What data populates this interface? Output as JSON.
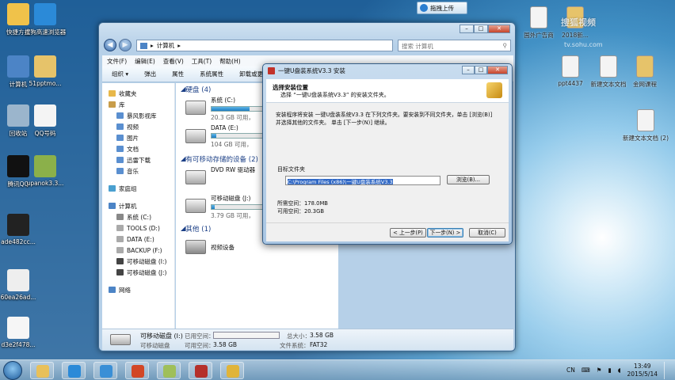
{
  "desktop": {
    "left_icons": [
      {
        "label": "快捷方式",
        "color": "#f0c24a"
      },
      {
        "label": "搜狗高速浏览器",
        "color": "#2b8ad8"
      },
      {
        "label": "计算机",
        "color": "#4c84c6"
      },
      {
        "label": "51pptmo...",
        "color": "#e6c36a"
      },
      {
        "label": "回收站",
        "color": "#9bb5cc"
      },
      {
        "label": "QQ号码",
        "color": "#f4f4f4"
      },
      {
        "label": "腾讯QQ",
        "color": "#111111"
      },
      {
        "label": "upanok3.3...",
        "color": "#8bb04a"
      },
      {
        "label": "ade482cc...",
        "color": "#222222"
      },
      {
        "label": "60ea26ad...",
        "color": "#eeeeee"
      },
      {
        "label": "d3e2f478...",
        "color": "#f6f6f6"
      }
    ],
    "right_icons": [
      {
        "label": "国外广告商",
        "color": "#f4f4f4"
      },
      {
        "label": "2018新...",
        "color": "#e6c36a"
      },
      {
        "label": "ppt4437",
        "color": "#f4f4f4"
      },
      {
        "label": "新建文本文档",
        "color": "#f4f4f4"
      },
      {
        "label": "金网课程",
        "color": "#e6c36a"
      },
      {
        "label": "新建文本文档 (2)",
        "color": "#f4f4f4"
      }
    ],
    "top_button": "拖拽上传",
    "watermark": "搜狐视频",
    "watermark_url": "tv.sohu.com"
  },
  "explorer": {
    "address": [
      "计算机"
    ],
    "search_placeholder": "搜索 计算机",
    "menu": [
      "文件(F)",
      "编辑(E)",
      "查看(V)",
      "工具(T)",
      "帮助(H)"
    ],
    "toolbar": [
      "组织 ▾",
      "弹出",
      "属性",
      "系统属性",
      "卸载或更改程序"
    ],
    "nav": [
      {
        "label": "收藏夹",
        "level": 0,
        "color": "#e8b84a"
      },
      {
        "label": "库",
        "level": 0,
        "color": "#c89d4a"
      },
      {
        "label": "暴风影视库",
        "level": 1,
        "color": "#5a8fd0"
      },
      {
        "label": "视频",
        "level": 1,
        "color": "#5a8fd0"
      },
      {
        "label": "图片",
        "level": 1,
        "color": "#5a8fd0"
      },
      {
        "label": "文档",
        "level": 1,
        "color": "#5a8fd0"
      },
      {
        "label": "迅雷下载",
        "level": 1,
        "color": "#5a8fd0"
      },
      {
        "label": "音乐",
        "level": 1,
        "color": "#5a8fd0"
      },
      {
        "label": "",
        "level": 0,
        "color": ""
      },
      {
        "label": "家庭组",
        "level": 0,
        "color": "#4aa0d0"
      },
      {
        "label": "",
        "level": 0,
        "color": ""
      },
      {
        "label": "计算机",
        "level": 0,
        "color": "#4c84c6"
      },
      {
        "label": "系统 (C:)",
        "level": 1,
        "color": "#888888"
      },
      {
        "label": "TOOLS (D:)",
        "level": 1,
        "color": "#aaaaaa"
      },
      {
        "label": "DATA (E:)",
        "level": 1,
        "color": "#aaaaaa"
      },
      {
        "label": "BACKUP (F:)",
        "level": 1,
        "color": "#aaaaaa"
      },
      {
        "label": "可移动磁盘 (I:)",
        "level": 1,
        "color": "#444444"
      },
      {
        "label": "可移动磁盘 (J:)",
        "level": 1,
        "color": "#444444"
      },
      {
        "label": "",
        "level": 0,
        "color": ""
      },
      {
        "label": "网络",
        "level": 0,
        "color": "#4c84c6"
      }
    ],
    "sections": {
      "disks": "硬盘 (4)",
      "removable": "有可移动存储的设备 (2)",
      "other": "其他 (1)"
    },
    "drives": [
      {
        "name": "系统 (C:)",
        "sub": "20.3 GB 可用，",
        "fill": 0.62
      },
      {
        "name": "DATA (E:)",
        "sub": "104 GB 可用，",
        "fill": 0.08
      }
    ],
    "removable": [
      {
        "name": "DVD RW 驱动器",
        "sub": "",
        "fill": -1
      },
      {
        "name": "可移动磁盘 (J:)",
        "sub": "3.79 GB 可用，",
        "fill": 0.05
      }
    ],
    "other": [
      {
        "name": "视频设备"
      }
    ],
    "status": {
      "name": "可移动磁盘 (I:)",
      "type": "可移动磁盘",
      "used_label": "已用空间：",
      "free_label": "可用空间：",
      "free_value": "3.58 GB",
      "total_label": "总大小：",
      "total_value": "3.58 GB",
      "fs_label": "文件系统：",
      "fs_value": "FAT32"
    }
  },
  "installer": {
    "title": "一键U盘装系统V3.3 安装",
    "header_title": "选择安装位置",
    "header_sub": "选择 “一键U盘装系统V3.3” 的安装文件夹。",
    "description": "安装程序将安装 一键U盘装系统V3.3 在下列文件夹。要安装到不同文件夹，单击 [浏览(B)] 并选择其他的文件夹。 单击 [下一步(N)] 继续。",
    "folder_label": "目标文件夹",
    "folder_value": "C:\\Program Files (x86)\\一键U盘装系统V3.3",
    "browse": "浏览(B)...",
    "required_label": "所需空间：",
    "required_value": "178.0MB",
    "available_label": "可用空间：",
    "available_value": "20.3GB",
    "back": "< 上一步(P)",
    "next": "下一步(N) >",
    "cancel": "取消(C)"
  },
  "taskbar": {
    "apps": [
      {
        "name": "explorer",
        "color": "#e8c05a"
      },
      {
        "name": "sogou",
        "color": "#2b8ad8"
      },
      {
        "name": "cloud",
        "color": "#3a8fd6"
      },
      {
        "name": "powerpoint",
        "color": "#d24726"
      },
      {
        "name": "notes",
        "color": "#9fbf5a"
      },
      {
        "name": "video",
        "color": "#b5302a"
      },
      {
        "name": "installer",
        "color": "#e0b43a"
      }
    ],
    "lang": "CN",
    "time": "13:49",
    "date": "2015/5/14"
  }
}
